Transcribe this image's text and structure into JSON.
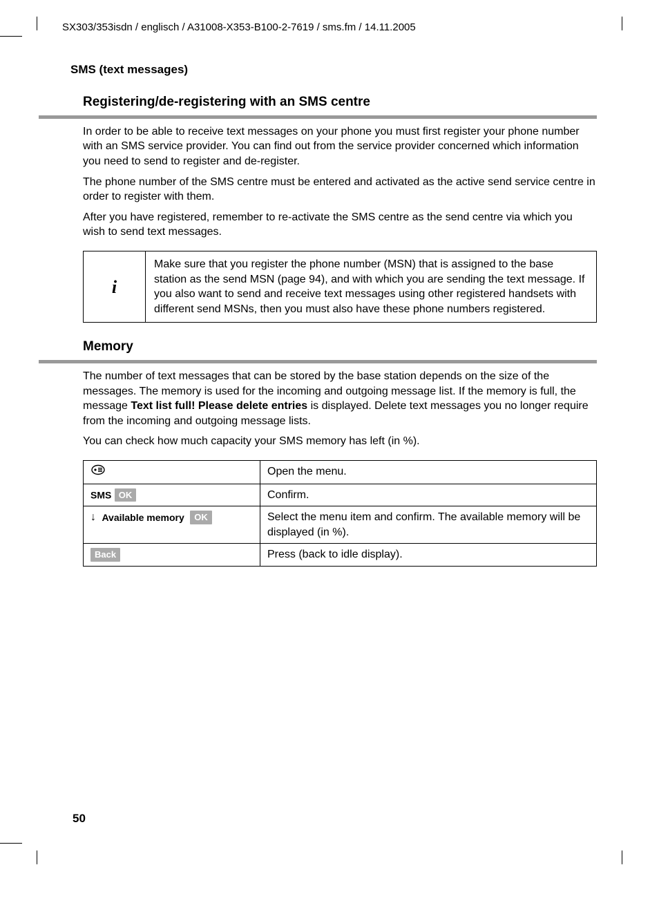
{
  "header": {
    "path": "SX303/353isdn / englisch / A31008-X353-B100-2-7619 / sms.fm / 14.11.2005"
  },
  "section_label": "SMS (text messages)",
  "section1": {
    "heading": "Registering/de-registering with an SMS centre",
    "p1": "In order to be able to receive text messages on your phone you must first register your phone number with an SMS service provider. You can find out from the service provider concerned which information you need to send to register and de-register.",
    "p2": "The phone number of the SMS centre must be entered and activated as the active send service centre in order to register with them.",
    "p3": "After you have registered, remember to re-activate the SMS centre as the send centre via which you wish to send text messages.",
    "info_icon": "i",
    "info_text": "Make sure that you register the phone number (MSN) that is assigned to the base station as the send MSN (page 94), and with which you are sending the text message. If you also want to send and receive text messages using other registered handsets with different send MSNs, then you must also have these phone numbers registered."
  },
  "section2": {
    "heading": "Memory",
    "p1_a": "The number of text messages that can be stored by the base station depends on the size of the messages. The memory is used for the incoming and outgoing message list. If the memory is full, the message ",
    "p1_bold": "Text list full! Please delete entries",
    "p1_b": " is displayed. Delete text messages you no longer require from the incoming and outgoing message lists.",
    "p2": "You can check how much capacity your SMS memory has left (in %)."
  },
  "steps": {
    "row1": {
      "desc": "Open the menu."
    },
    "row2": {
      "label": "SMS",
      "key": "OK",
      "desc": "Confirm."
    },
    "row3": {
      "arrow": "↓",
      "item": "Available memory",
      "key": "OK",
      "desc": "Select the menu item and confirm. The available memory will be displayed (in %)."
    },
    "row4": {
      "key": "Back",
      "desc": "Press (back to idle display)."
    }
  },
  "page_number": "50"
}
